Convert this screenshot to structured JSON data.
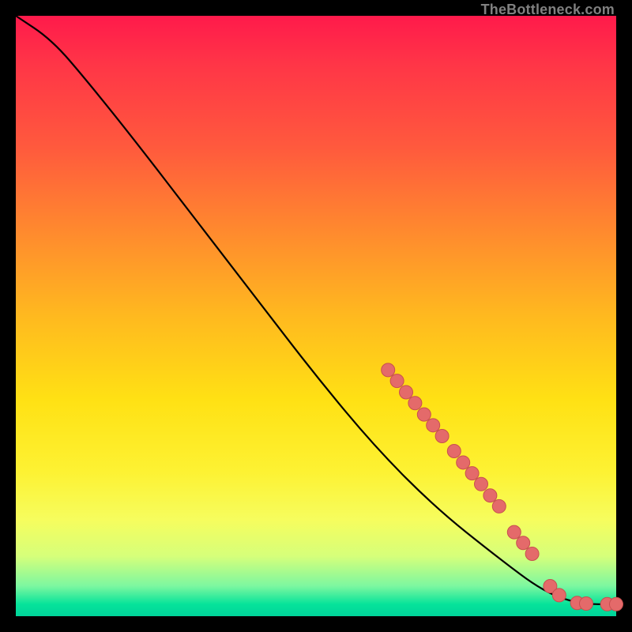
{
  "attribution": "TheBottleneck.com",
  "chart_data": {
    "type": "line",
    "title": "",
    "xlabel": "",
    "ylabel": "",
    "xlim": [
      0,
      100
    ],
    "ylim": [
      0,
      100
    ],
    "curve": [
      {
        "x": 0,
        "y": 100
      },
      {
        "x": 6,
        "y": 96
      },
      {
        "x": 12,
        "y": 89
      },
      {
        "x": 20,
        "y": 79
      },
      {
        "x": 30,
        "y": 66
      },
      {
        "x": 40,
        "y": 53
      },
      {
        "x": 50,
        "y": 40
      },
      {
        "x": 60,
        "y": 28
      },
      {
        "x": 70,
        "y": 18
      },
      {
        "x": 80,
        "y": 10
      },
      {
        "x": 88,
        "y": 4
      },
      {
        "x": 94,
        "y": 2
      },
      {
        "x": 100,
        "y": 2
      }
    ],
    "points": [
      {
        "x": 62,
        "y": 41
      },
      {
        "x": 63.5,
        "y": 39.2
      },
      {
        "x": 65,
        "y": 37.3
      },
      {
        "x": 66.5,
        "y": 35.5
      },
      {
        "x": 68,
        "y": 33.6
      },
      {
        "x": 69.5,
        "y": 31.8
      },
      {
        "x": 71,
        "y": 30
      },
      {
        "x": 73,
        "y": 27.5
      },
      {
        "x": 74.5,
        "y": 25.6
      },
      {
        "x": 76,
        "y": 23.8
      },
      {
        "x": 77.5,
        "y": 22
      },
      {
        "x": 79,
        "y": 20.1
      },
      {
        "x": 80.5,
        "y": 18.3
      },
      {
        "x": 83,
        "y": 14
      },
      {
        "x": 84.5,
        "y": 12.2
      },
      {
        "x": 86,
        "y": 10.4
      },
      {
        "x": 89,
        "y": 5
      },
      {
        "x": 90.5,
        "y": 3.5
      },
      {
        "x": 93.5,
        "y": 2.2
      },
      {
        "x": 95,
        "y": 2.1
      },
      {
        "x": 98.5,
        "y": 2
      },
      {
        "x": 100,
        "y": 2
      }
    ]
  }
}
